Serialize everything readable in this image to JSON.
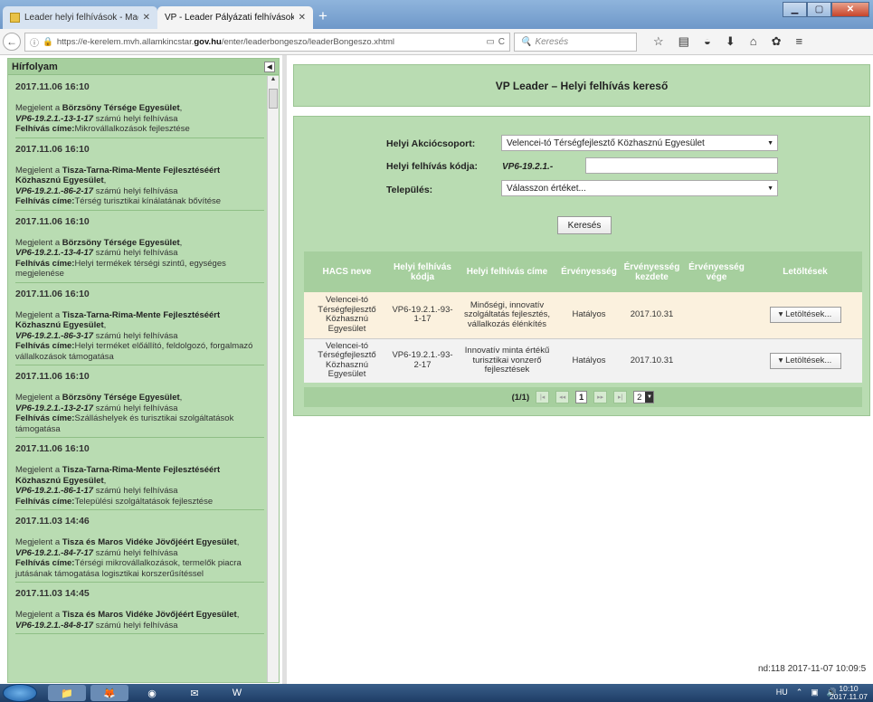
{
  "browser": {
    "tabs": [
      {
        "label": "Leader helyi felhívások - Mag"
      },
      {
        "label": "VP - Leader Pályázati felhívások b"
      }
    ],
    "url_prefix": "https://e-kerelem.mvh.allamkincstar.",
    "url_domain": "gov.hu",
    "url_suffix": "/enter/leaderbongeszo/leaderBongeszo.xhtml",
    "search_placeholder": "Keresés"
  },
  "sidebar": {
    "title": "Hírfolyam",
    "items": [
      {
        "date": "2017.11.06 16:10",
        "pre": "Megjelent a ",
        "org": "Börzsöny Térsége Egyesület",
        "code": "VP6-19.2.1.-13-1-17",
        "code_suffix": " számú helyi felhívása",
        "title_label": "Felhívás címe:",
        "title": "Mikrovállalkozások fejlesztése"
      },
      {
        "date": "2017.11.06 16:10",
        "pre": "Megjelent a ",
        "org": "Tisza-Tarna-Rima-Mente Fejlesztéséért Közhasznú Egyesület",
        "code": "VP6-19.2.1.-86-2-17",
        "code_suffix": " számú helyi felhívása",
        "title_label": "Felhívás címe:",
        "title": "Térség turisztikai kínálatának bővítése"
      },
      {
        "date": "2017.11.06 16:10",
        "pre": "Megjelent a ",
        "org": "Börzsöny Térsége Egyesület",
        "code": "VP6-19.2.1.-13-4-17",
        "code_suffix": " számú helyi felhívása",
        "title_label": "Felhívás címe:",
        "title": "Helyi termékek térségi szintű, egységes megjelenése"
      },
      {
        "date": "2017.11.06 16:10",
        "pre": "Megjelent a ",
        "org": "Tisza-Tarna-Rima-Mente Fejlesztéséért Közhasznú Egyesület",
        "code": "VP6-19.2.1.-86-3-17",
        "code_suffix": " számú helyi felhívása",
        "title_label": "Felhívás címe:",
        "title": "Helyi terméket előállító, feldolgozó, forgalmazó vállalkozások támogatása"
      },
      {
        "date": "2017.11.06 16:10",
        "pre": "Megjelent a ",
        "org": "Börzsöny Térsége Egyesület",
        "code": "VP6-19.2.1.-13-2-17",
        "code_suffix": " számú helyi felhívása",
        "title_label": "Felhívás címe:",
        "title": "Szálláshelyek és turisztikai szolgáltatások támogatása"
      },
      {
        "date": "2017.11.06 16:10",
        "pre": "Megjelent a ",
        "org": "Tisza-Tarna-Rima-Mente Fejlesztéséért Közhasznú Egyesület",
        "code": "VP6-19.2.1.-86-1-17",
        "code_suffix": " számú helyi felhívása",
        "title_label": "Felhívás címe:",
        "title": "Települési szolgáltatások fejlesztése"
      },
      {
        "date": "2017.11.03 14:46",
        "pre": "Megjelent a ",
        "org": "Tisza és Maros Vidéke Jövőjéért Egyesület",
        "code": "VP6-19.2.1.-84-7-17",
        "code_suffix": " számú helyi felhívása",
        "title_label": "Felhívás címe:",
        "title": "Térségi mikrovállalkozások, termelők piacra jutásának támogatása logisztikai korszerűsítéssel"
      },
      {
        "date": "2017.11.03 14:45",
        "pre": "Megjelent a ",
        "org": "Tisza és Maros Vidéke Jövőjéért Egyesület",
        "code": "VP6-19.2.1.-84-8-17",
        "code_suffix": " számú helyi felhívása",
        "title_label": "",
        "title": ""
      }
    ]
  },
  "header": {
    "title": "VP Leader – Helyi felhívás kereső"
  },
  "form": {
    "akcio_label": "Helyi Akciócsoport:",
    "akcio_value": "Velencei-tó Térségfejlesztő Közhasznú Egyesület",
    "kod_label": "Helyi felhívás kódja:",
    "kod_prefix": "VP6-19.2.1.-",
    "telepules_label": "Település:",
    "telepules_value": "Válasszon értéket...",
    "search_button": "Keresés"
  },
  "table": {
    "headers": [
      "HACS neve",
      "Helyi felhívás kódja",
      "Helyi felhívás címe",
      "Érvényesség",
      "Érvényesség kezdete",
      "Érvényesség vége",
      "Letöltések"
    ],
    "rows": [
      {
        "hacs": "Velencei-tó Térségfejlesztő Közhasznú Egyesület",
        "kod": "VP6-19.2.1.-93-1-17",
        "cim": "Minőségi, innovatív szolgáltatás fejlesztés, vállalkozás élénkítés",
        "ervenyesseg": "Hatályos",
        "kezdete": "2017.10.31",
        "vege": "",
        "letoltes": "Letöltések..."
      },
      {
        "hacs": "Velencei-tó Térségfejlesztő Közhasznú Egyesület",
        "kod": "VP6-19.2.1.-93-2-17",
        "cim": "Innovatív minta értékű turisztikai vonzerő fejlesztések",
        "ervenyesseg": "Hatályos",
        "kezdete": "2017.10.31",
        "vege": "",
        "letoltes": "Letöltések..."
      }
    ],
    "pager": {
      "info": "(1/1)",
      "current_page": "1",
      "rows_per_page": "2"
    }
  },
  "status": {
    "text": "nd:118  2017-11-07 10:09:5"
  },
  "taskbar": {
    "lang": "HU",
    "time": "10:10",
    "date": "2017.11.07"
  }
}
